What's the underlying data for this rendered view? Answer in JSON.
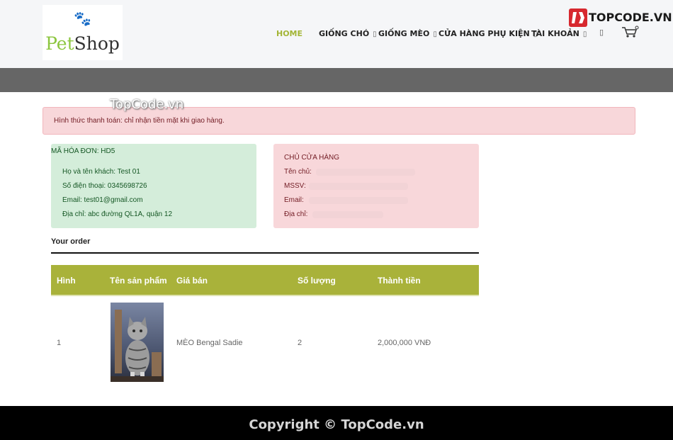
{
  "header": {
    "logo_text_1": "Pet",
    "logo_text_2": "Shop",
    "logo_paw": "🐾",
    "nav": [
      {
        "label": "HOME",
        "has_caret": false,
        "active": true
      },
      {
        "label": "GIỐNG CHÓ",
        "has_caret": true
      },
      {
        "label": "GIỐNG MÈO",
        "has_caret": true
      },
      {
        "label": "CỬA HÀNG PHỤ KIỆN",
        "has_caret": true
      },
      {
        "label": "TÀI KHOẢN",
        "has_caret": true
      }
    ],
    "caret_glyph": "▯",
    "search_glyph": "▯",
    "accent_color": "#a3b536"
  },
  "watermark": {
    "topcode_logo": "TOPCODE.VN",
    "center_text": "TopCode.vn"
  },
  "alert": {
    "text": "Hình thức thanh toán: chỉ nhận tiền mặt khi giao hàng."
  },
  "invoice": {
    "title": "MÃ HÓA ĐƠN: HD5",
    "name_line": "Họ và tên khách: Test 01",
    "phone_line": "Số điện thoại: 0345698726",
    "email_line": "Email: test01@gmail.com",
    "address_line": "Địa chỉ: abc đường QL1A, quận 12"
  },
  "owner": {
    "title": "CHỦ CỬA HÀNG",
    "name_label": "Tên chủ:",
    "student_id_label": "MSSV:",
    "email_label": "Email:",
    "address_label": "Địa chỉ:"
  },
  "order": {
    "title": "Your order",
    "columns": [
      "Hình",
      "Tên sản phẩm",
      "Giá bán",
      "Số lượng",
      "Thành tiền"
    ],
    "header_color": "#a9b23a",
    "rows": [
      {
        "index": "1",
        "product": "MÈO Bengal Sadie",
        "quantity": "2",
        "total": "2,000,000 VNĐ"
      }
    ]
  },
  "footer": {
    "text": "Copyright © TopCode.vn"
  }
}
